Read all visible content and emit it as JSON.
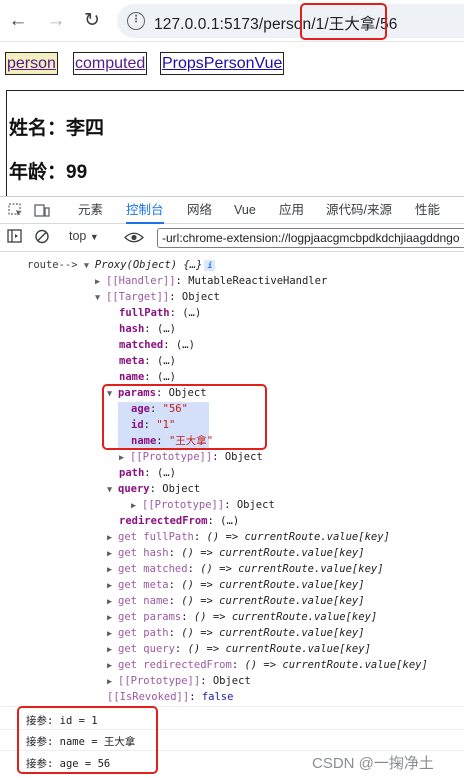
{
  "browser": {
    "back_icon": "←",
    "forward_icon": "→",
    "reload_icon": "↻",
    "url": "127.0.0.1:5173/person/1/王大拿/56"
  },
  "links": [
    {
      "label": "person",
      "state": "active"
    },
    {
      "label": "computed",
      "state": "visited"
    },
    {
      "label": "PropsPersonVue",
      "state": "unvisited"
    }
  ],
  "content": {
    "name_line": "姓名：李四",
    "age_line": "年龄：99"
  },
  "devtools": {
    "tabs": [
      "元素",
      "控制台",
      "网络",
      "Vue",
      "应用",
      "源代码/来源",
      "性能"
    ],
    "active_tab": "控制台",
    "toolbar": {
      "context": "top",
      "filter": "-url:chrome-extension://logpjaacgmcbpdkdchjiaagddngo"
    },
    "tree": {
      "label": "route-->",
      "root": "Proxy(Object) {…}",
      "handler_key": "[[Handler]]",
      "handler_val": "MutableReactiveHandler",
      "target_key": "[[Target]]",
      "target_val": "Object",
      "ellipsis": "(…)",
      "object_word": "Object",
      "fullPath": "fullPath",
      "hash": "hash",
      "matched": "matched",
      "meta": "meta",
      "name": "name",
      "params": "params",
      "age_key": "age",
      "age_val": "\"56\"",
      "id_key": "id",
      "id_val": "\"1\"",
      "pname_key": "name",
      "pname_val": "\"王大拿\"",
      "proto": "[[Prototype]]",
      "path": "path",
      "query": "query",
      "redirectedFrom": "redirectedFrom",
      "getters": [
        "fullPath",
        "hash",
        "matched",
        "meta",
        "name",
        "params",
        "path",
        "query",
        "redirectedFrom"
      ],
      "getter_prefix": "get",
      "getter_body": "() => currentRoute.value[key]",
      "revoked_key": "[[IsRevoked]]",
      "revoked_val": "false"
    },
    "logs": [
      "接参: id =  1",
      "接参: name =  王大拿",
      "接参: age =  56"
    ]
  },
  "watermark": "CSDN @一掬净土",
  "colors": {
    "highlight_border": "#e0201a",
    "active_tab": "#1a73e8",
    "key": "#881280",
    "string": "#c41a16"
  }
}
